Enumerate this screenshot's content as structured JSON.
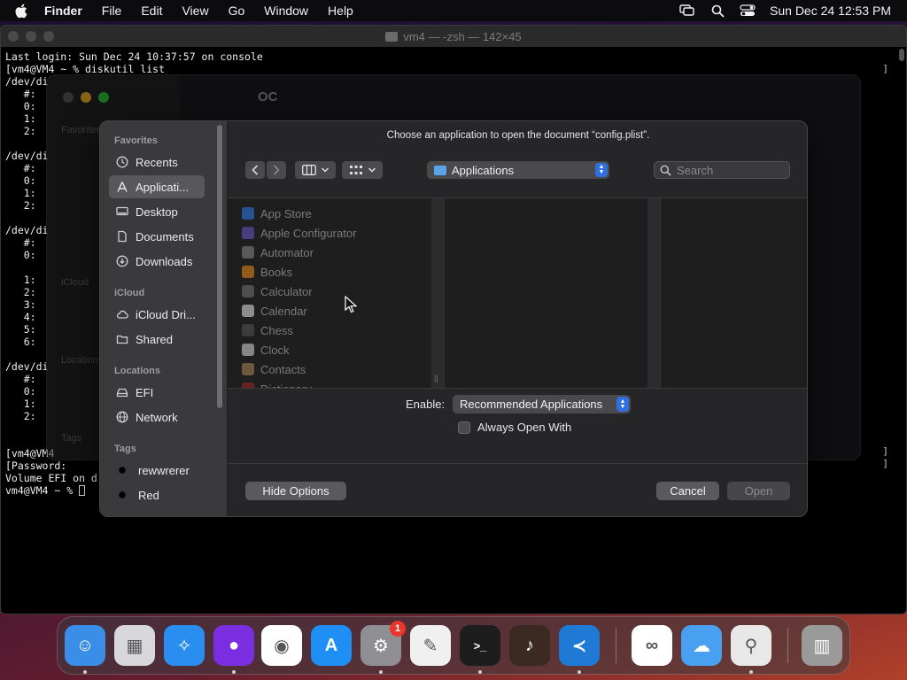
{
  "menubar": {
    "app_name": "Finder",
    "menus": [
      "File",
      "Edit",
      "View",
      "Go",
      "Window",
      "Help"
    ],
    "clock": "Sun Dec 24  12:53 PM"
  },
  "terminal": {
    "title": "vm4 — -zsh — 142×45",
    "lines": [
      "Last login: Sun Dec 24 10:37:57 on console",
      "[vm4@VM4 ~ % diskutil list",
      "/dev/di",
      "   #:",
      "   0:",
      "   1:",
      "   2:",
      "",
      "/dev/di",
      "   #:",
      "   0:",
      "   1:",
      "   2:",
      "",
      "/dev/di",
      "   #:",
      "   0:",
      "",
      "   1:",
      "   2:",
      "   3:",
      "   4:",
      "   5:",
      "   6:",
      "",
      "/dev/di",
      "   #:",
      "   0:",
      "   1:",
      "   2:",
      "",
      "",
      "[vm4@VM4",
      "[Password:",
      "Volume EFI on d",
      "vm4@VM4 ~ % "
    ]
  },
  "background_finder": {
    "title": "OC",
    "sidebar_labels": [
      "Favorites",
      "iCloud",
      "Locations",
      "Tags"
    ]
  },
  "dialog": {
    "prompt": "Choose an application to open the document “config.plist”.",
    "sidebar": {
      "favorites_label": "Favorites",
      "favorites": [
        {
          "label": "Recents",
          "icon": "clock-icon"
        },
        {
          "label": "Applicati...",
          "icon": "applications-icon",
          "active": true
        },
        {
          "label": "Desktop",
          "icon": "desktop-icon"
        },
        {
          "label": "Documents",
          "icon": "document-icon"
        },
        {
          "label": "Downloads",
          "icon": "download-icon"
        }
      ],
      "icloud_label": "iCloud",
      "icloud": [
        {
          "label": "iCloud Dri...",
          "icon": "cloud-icon"
        },
        {
          "label": "Shared",
          "icon": "shared-folder-icon"
        }
      ],
      "locations_label": "Locations",
      "locations": [
        {
          "label": "EFI",
          "icon": "drive-icon"
        },
        {
          "label": "Network",
          "icon": "globe-icon"
        }
      ],
      "tags_label": "Tags",
      "tags": [
        {
          "label": "rewwrerer",
          "color": "#000000"
        },
        {
          "label": "Red",
          "color": "#000000"
        }
      ]
    },
    "location": "Applications",
    "search_placeholder": "Search",
    "apps": [
      {
        "name": "App Store",
        "color": "#2d7ff0"
      },
      {
        "name": "Apple Configurator",
        "color": "#6a5acd"
      },
      {
        "name": "Automator",
        "color": "#8a8a8a"
      },
      {
        "name": "Books",
        "color": "#f28a1e"
      },
      {
        "name": "Calculator",
        "color": "#777777"
      },
      {
        "name": "Calendar",
        "color": "#e8e8e8"
      },
      {
        "name": "Chess",
        "color": "#555555"
      },
      {
        "name": "Clock",
        "color": "#dddddd"
      },
      {
        "name": "Contacts",
        "color": "#b08a5a"
      },
      {
        "name": "Dictionary",
        "color": "#a02a2a"
      }
    ],
    "enable_label": "Enable:",
    "enable_value": "Recommended Applications",
    "always_open_label": "Always Open With",
    "hide_options_label": "Hide Options",
    "cancel_label": "Cancel",
    "open_label": "Open"
  },
  "dock": {
    "items": [
      {
        "name": "finder",
        "color": "#3a8ee8",
        "running": true
      },
      {
        "name": "launchpad",
        "color": "#d7d7dc",
        "running": false
      },
      {
        "name": "safari",
        "color": "#2a8ef0",
        "running": false
      },
      {
        "name": "firefox",
        "color": "#7a2ee0",
        "running": true
      },
      {
        "name": "chrome",
        "color": "#ffffff",
        "running": false
      },
      {
        "name": "app-store",
        "color": "#1f8ef5",
        "running": false
      },
      {
        "name": "system-settings",
        "color": "#8e8e93",
        "running": true,
        "badge": "1"
      },
      {
        "name": "textedit",
        "color": "#f0f0f0",
        "running": false
      },
      {
        "name": "terminal",
        "color": "#1d1d1d",
        "running": true
      },
      {
        "name": "garageband",
        "color": "#3a2a22",
        "running": false
      },
      {
        "name": "vscode",
        "color": "#1f7ad6",
        "running": true
      },
      {
        "name": "visual-studio",
        "color": "#ffffff",
        "running": false
      },
      {
        "name": "weather",
        "color": "#4aa0f0",
        "running": false
      },
      {
        "name": "system-information",
        "color": "#e8e8e8",
        "running": true
      },
      {
        "name": "trash",
        "color": "#9a9a9a",
        "running": false
      }
    ]
  }
}
